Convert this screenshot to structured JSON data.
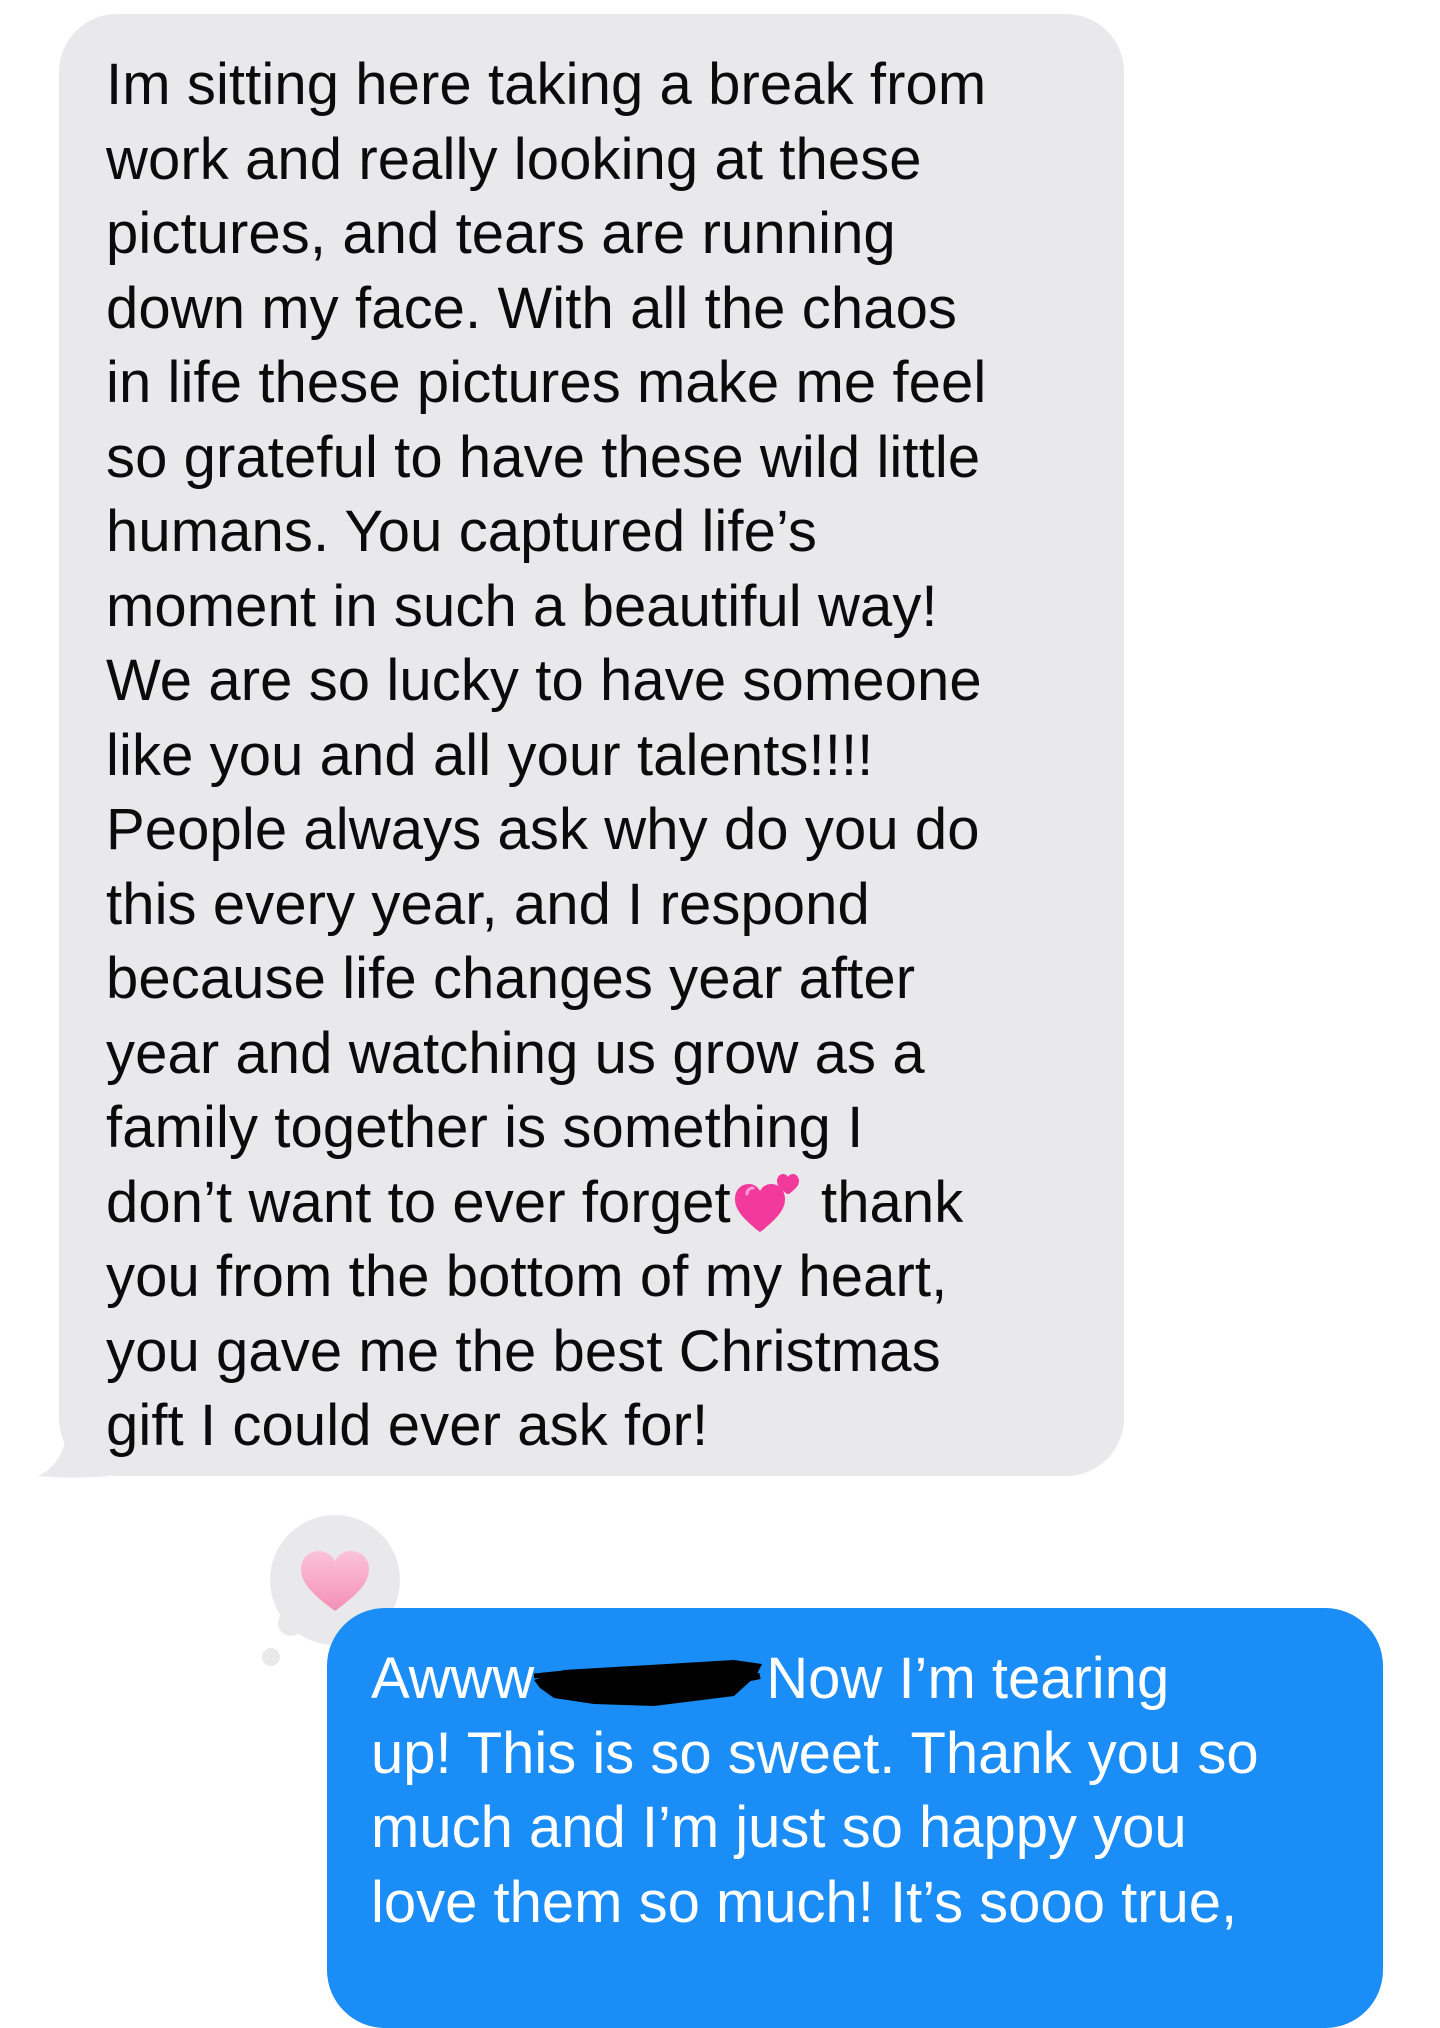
{
  "colors": {
    "incoming_bubble": "#e9e9eb",
    "outgoing_bubble": "#1b8df6",
    "incoming_text": "#0b0b0b",
    "outgoing_text": "#ffffff",
    "redaction": "#000000",
    "heart": "#f7a8c7"
  },
  "incoming": {
    "text_before_emoji": "Im sitting here taking a break from\nwork and really looking at these\npictures, and tears are running\ndown my face. With all the chaos\nin life these pictures make me feel\nso grateful to have these wild little\nhumans. You captured life’s\nmoment in such a beautiful way!\nWe are so lucky to have someone\nlike you and all your talents!!!!\nPeople always ask why do you do\nthis every year, and I respond\nbecause life changes year after\nyear and watching us grow as a\nfamily together is something I\ndon’t want to ever forget",
    "emoji": "two-hearts-icon",
    "text_after_emoji": " thank\nyou from the bottom of my heart,\nyou gave me the best Christmas\ngift I could ever ask for!"
  },
  "tapback": {
    "icon": "pink-heart-icon"
  },
  "outgoing": {
    "text_before_redaction": "Awww",
    "text_after_redaction": "Now I’m tearing\nup! This is so sweet. Thank you so\nmuch and I’m just so happy you\nlove them so much! It’s sooo true,"
  }
}
